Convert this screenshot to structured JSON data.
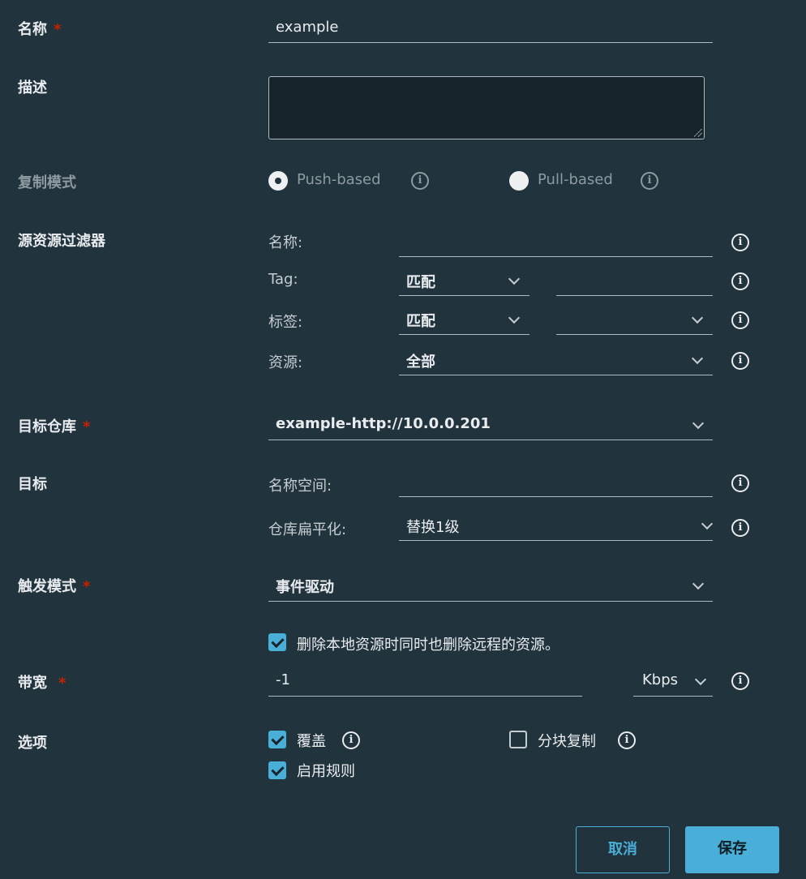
{
  "form": {
    "name": {
      "label": "名称",
      "required": "*",
      "value": "example"
    },
    "description": {
      "label": "描述",
      "value": ""
    },
    "replication_mode": {
      "label": "复制模式",
      "options": [
        "Push-based",
        "Pull-based"
      ],
      "selected": "Push-based"
    },
    "source_filter": {
      "label": "源资源过滤器",
      "name_label": "名称:",
      "name_value": "",
      "tag_label": "Tag:",
      "tag_match": "匹配",
      "tag_value": "",
      "label_label": "标签:",
      "label_match": "匹配",
      "label_value": "",
      "resource_label": "资源:",
      "resource_value": "全部"
    },
    "target_registry": {
      "label": "目标仓库",
      "required": "*",
      "value": "example-http://10.0.0.201"
    },
    "target": {
      "label": "目标",
      "namespace_label": "名称空间:",
      "namespace_value": "",
      "flatten_label": "仓库扁平化:",
      "flatten_value": "替换1级"
    },
    "trigger_mode": {
      "label": "触发模式",
      "required": "*",
      "value": "事件驱动",
      "delete_remote_label": "删除本地资源时同时也删除远程的资源。",
      "delete_remote_checked": true
    },
    "bandwidth": {
      "label": "带宽",
      "required": "*",
      "value": "-1",
      "unit": "Kbps"
    },
    "options": {
      "label": "选项",
      "override_label": "覆盖",
      "override_checked": true,
      "chunked_label": "分块复制",
      "chunked_checked": false,
      "enable_rule_label": "启用规则",
      "enable_rule_checked": true
    }
  },
  "buttons": {
    "cancel": "取消",
    "save": "保存"
  },
  "icons": {
    "info": "i"
  },
  "colors": {
    "accent": "#49afd9",
    "required": "#c92100",
    "background": "#21333d"
  }
}
